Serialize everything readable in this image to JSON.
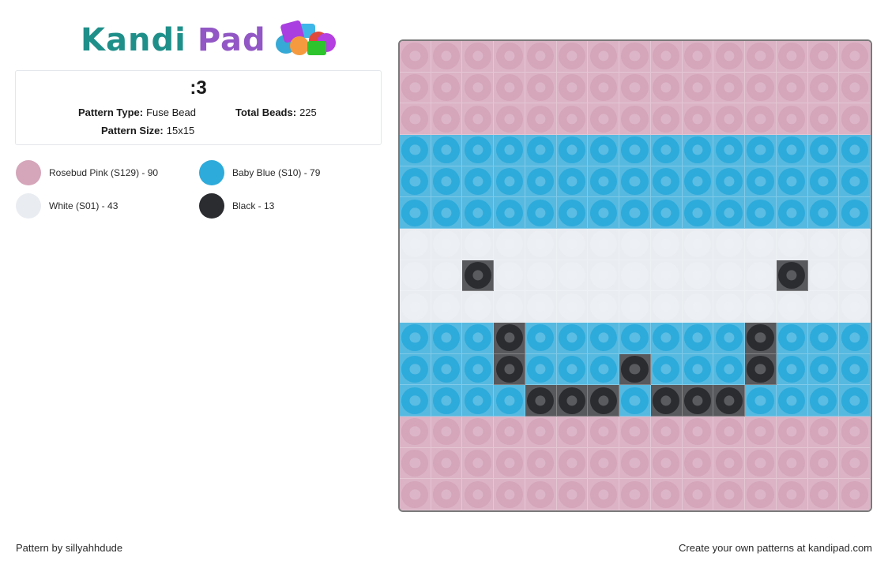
{
  "logo": {
    "part1": "Kandi",
    "part2": "Pad"
  },
  "pattern": {
    "title": ":3",
    "type_label": "Pattern Type:",
    "type_value": "Fuse Bead",
    "total_label": "Total Beads:",
    "total_value": "225",
    "size_label": "Pattern Size:",
    "size_value": "15x15"
  },
  "colors": [
    {
      "key": "P",
      "name": "Rosebud Pink (S129) - 90",
      "hex": "#d5a5b9",
      "bg": "#dbb3c5",
      "hole": "#dcb6c8"
    },
    {
      "key": "B",
      "name": "Baby Blue (S10) - 79",
      "hex": "#2dabdb",
      "bg": "#56b9e0",
      "hole": "#5bbde3"
    },
    {
      "key": "W",
      "name": "White (S01) - 43",
      "hex": "#e9ecf1",
      "bg": "#e9ecf1",
      "hole": "#edf0f4"
    },
    {
      "key": "K",
      "name": "Black - 13",
      "hex": "#2b2c30",
      "bg": "#58595c",
      "hole": "#5a5b5e"
    }
  ],
  "grid": [
    "PPPPPPPPPPPPPPP",
    "PPPPPPPPPPPPPPP",
    "PPPPPPPPPPPPPPP",
    "BBBBBBBBBBBBBBB",
    "BBBBBBBBBBBBBBB",
    "BBBBBBBBBBBBBBB",
    "WWWWWWWWWWWWWWW",
    "WWKWWWWWWWWWKWW",
    "WWWWWWWWWWWWWWW",
    "BBBKBBBBBBBKBBB",
    "BBBKBBBKBBBKBBB",
    "BBBBKKKBKKKBBBB",
    "PPPPPPPPPPPPPPP",
    "PPPPPPPPPPPPPPP",
    "PPPPPPPPPPPPPPP"
  ],
  "footer": {
    "author": "Pattern by sillyahhdude",
    "promo": "Create your own patterns at kandipad.com"
  }
}
